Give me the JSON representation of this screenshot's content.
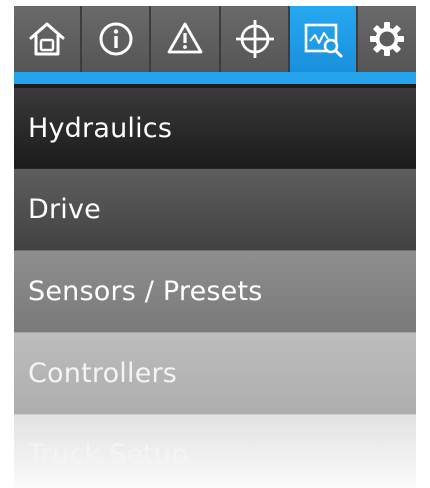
{
  "tabs": [
    {
      "icon": "home-icon",
      "active": false
    },
    {
      "icon": "info-icon",
      "active": false
    },
    {
      "icon": "warning-icon",
      "active": false
    },
    {
      "icon": "crosshair-icon",
      "active": false
    },
    {
      "icon": "chart-search-icon",
      "active": true
    },
    {
      "icon": "gear-icon",
      "active": false
    }
  ],
  "colors": {
    "accent": "#27a2ec",
    "tab_bg": "#5a5a5a"
  },
  "menu": {
    "items": [
      {
        "label": "Hydraulics"
      },
      {
        "label": "Drive"
      },
      {
        "label": "Sensors / Presets"
      },
      {
        "label": "Controllers"
      },
      {
        "label": "Truck Setup"
      }
    ]
  }
}
